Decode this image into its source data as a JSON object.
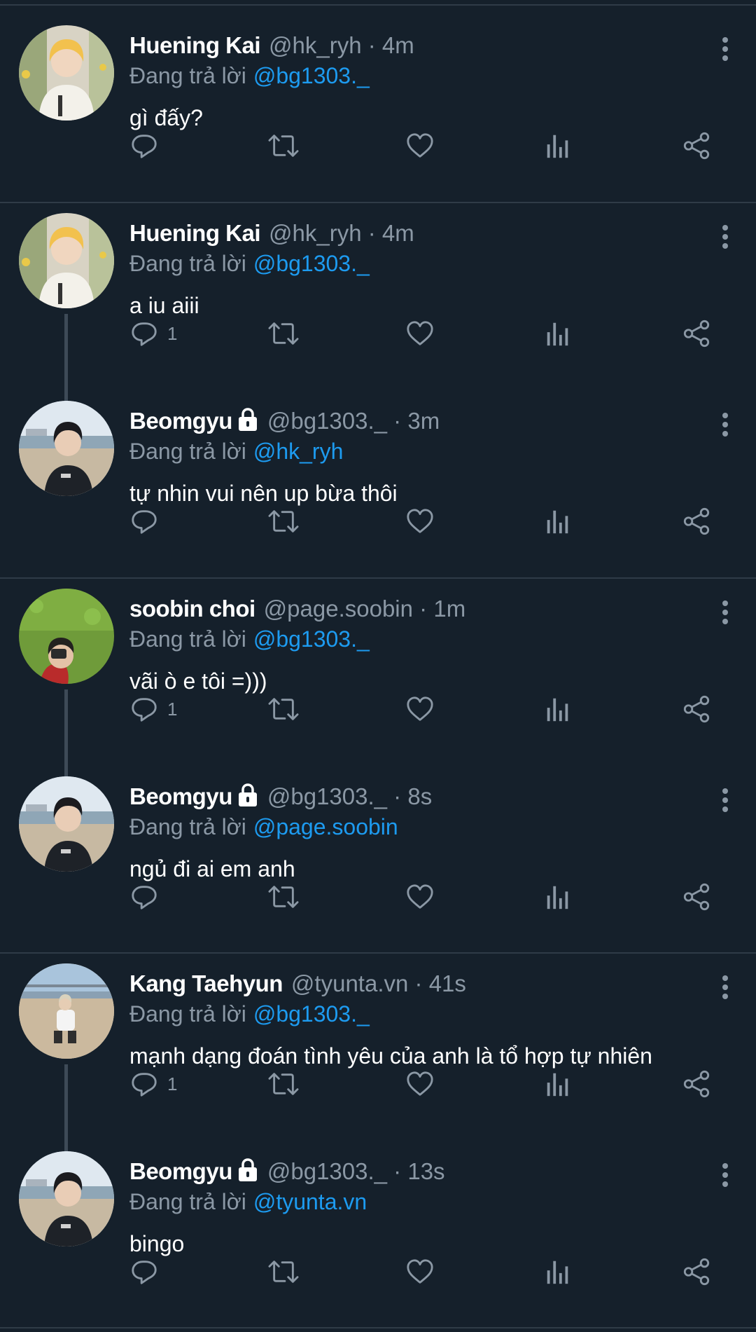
{
  "colors": {
    "background": "#15202b",
    "divider": "#2f3b47",
    "muted_text": "#8b98a5",
    "mention_blue": "#1d9bf0",
    "icon_gray": "#8b98a5"
  },
  "icons": {
    "reply": "reply-icon",
    "retweet": "retweet-icon",
    "like": "heart-icon",
    "analytics": "analytics-icon",
    "share": "share-icon",
    "more": "more-vertical-icon",
    "protected": "lock-icon"
  },
  "tweets": [
    {
      "name": "Huening Kai",
      "handle": "@hk_ryh",
      "separator": "·",
      "time": "4m",
      "protected": false,
      "replying_label": "Đang trả lời",
      "replying_to": "@bg1303._",
      "text": "gì đấy?",
      "reply_count": ""
    },
    {
      "name": "Huening Kai",
      "handle": "@hk_ryh",
      "separator": "·",
      "time": "4m",
      "protected": false,
      "replying_label": "Đang trả lời",
      "replying_to": "@bg1303._",
      "text": "a iu aiii",
      "reply_count": "1"
    },
    {
      "name": "Beomgyu",
      "handle": "@bg1303._",
      "separator": "·",
      "time": "3m",
      "protected": true,
      "replying_label": "Đang trả lời",
      "replying_to": "@hk_ryh",
      "text": "tự nhin vui nên up bừa thôi",
      "reply_count": ""
    },
    {
      "name": "soobin choi",
      "handle": "@page.soobin",
      "separator": "·",
      "time": "1m",
      "protected": false,
      "replying_label": "Đang trả lời",
      "replying_to": "@bg1303._",
      "text": "vãi ò e tôi =)))",
      "reply_count": "1"
    },
    {
      "name": "Beomgyu",
      "handle": "@bg1303._",
      "separator": "·",
      "time": "8s",
      "protected": true,
      "replying_label": "Đang trả lời",
      "replying_to": "@page.soobin",
      "text": "ngủ đi ai em anh",
      "reply_count": ""
    },
    {
      "name": "Kang Taehyun",
      "handle": "@tyunta.vn",
      "separator": "·",
      "time": "41s",
      "protected": false,
      "replying_label": "Đang trả lời",
      "replying_to": "@bg1303._",
      "text": "mạnh dạng đoán tình yêu của anh là tổ hợp tự nhiên",
      "reply_count": "1"
    },
    {
      "name": "Beomgyu",
      "handle": "@bg1303._",
      "separator": "·",
      "time": "13s",
      "protected": true,
      "replying_label": "Đang trả lời",
      "replying_to": "@tyunta.vn",
      "text": "bingo",
      "reply_count": ""
    }
  ]
}
